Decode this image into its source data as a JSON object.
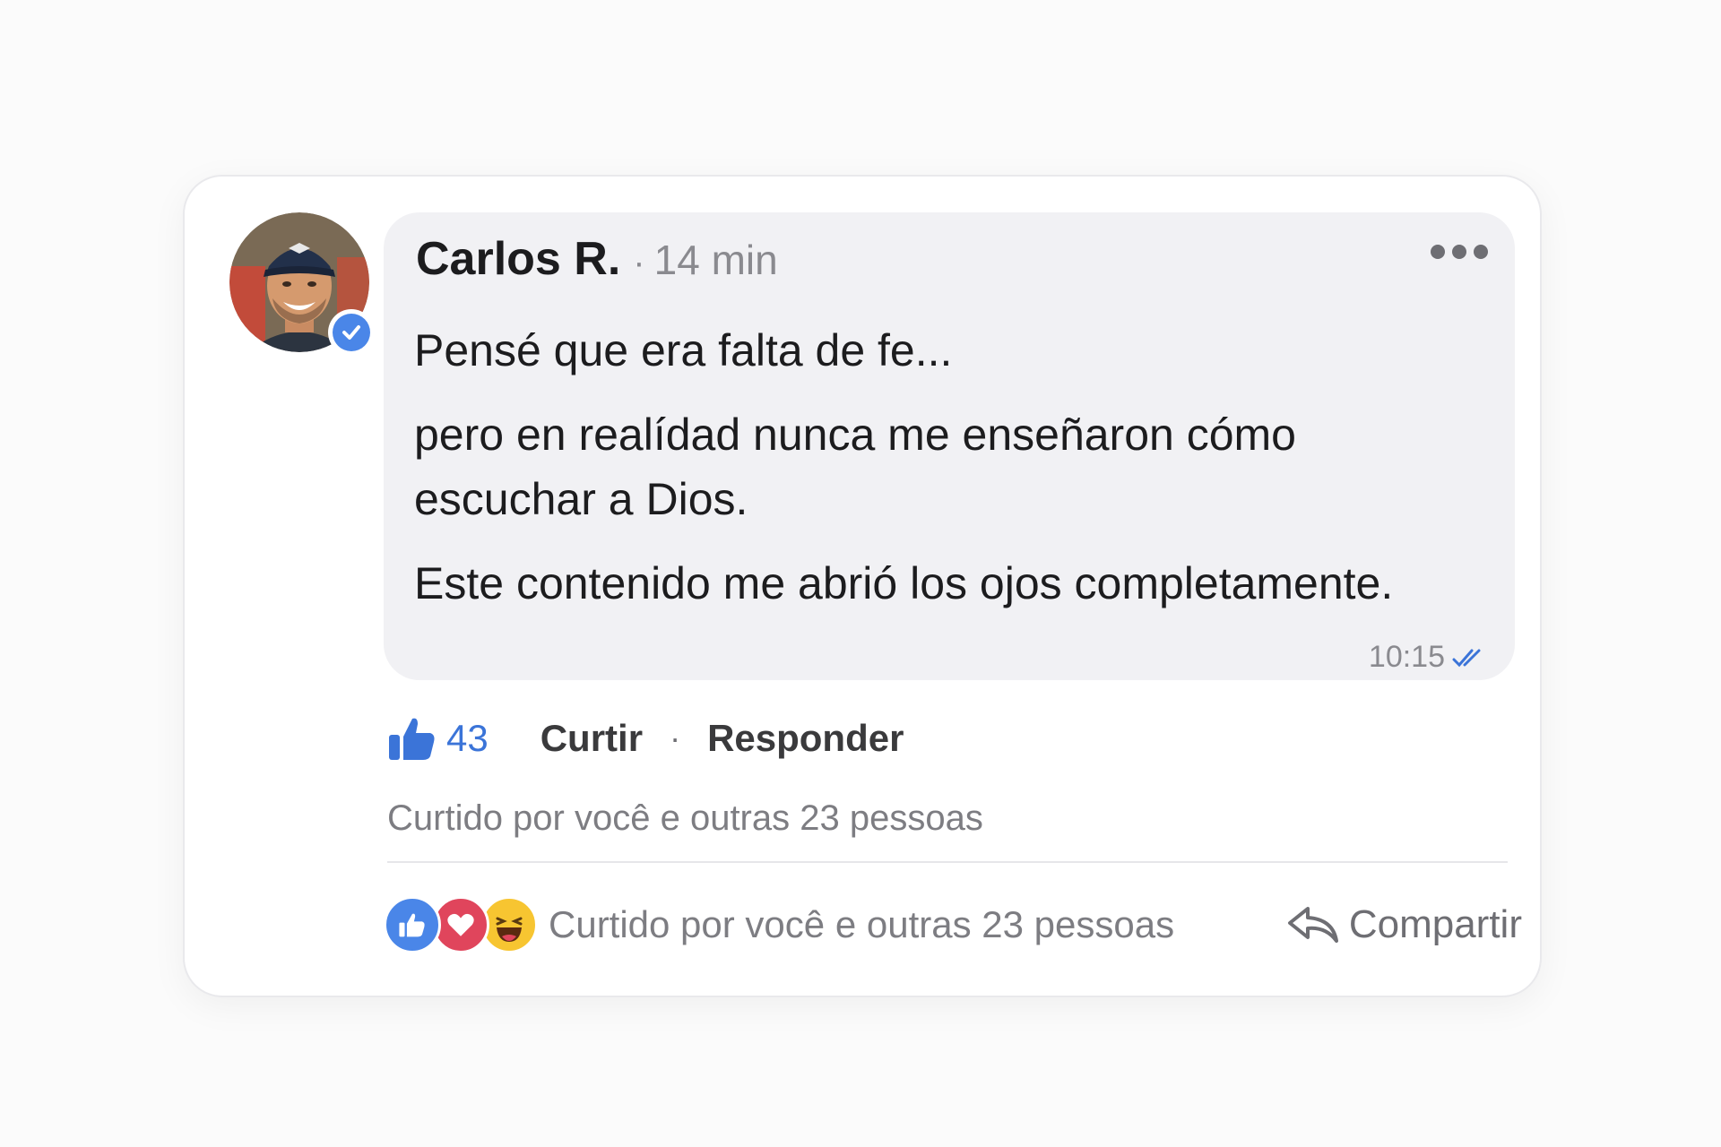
{
  "comment": {
    "author": "Carlos R.",
    "separator": "·",
    "time_ago": "14 min",
    "verified": true,
    "lines": [
      "Pensé que era falta de fe...",
      "pero en realídad nunca me enseñaron cómo escuchar a Dios.",
      "Este contenido me abrió los ojos completamente."
    ],
    "timestamp": "10:15",
    "read_receipt_color": "#3b74d8",
    "bubble_color": "#f1f1f4"
  },
  "actions": {
    "like_count": "43",
    "like_label": "Curtir",
    "separator": "·",
    "reply_label": "Responder"
  },
  "liked_by": "Curtido por você e outras 23 pessoas",
  "footer": {
    "reactions": [
      "thumbs-up-icon",
      "heart-icon",
      "laughing-face-icon"
    ],
    "text": "Curtido por você e outras 23 pessoas",
    "share_label": "Compartir"
  },
  "colors": {
    "accent": "#3b74d8",
    "like_reaction": "#4a86e8",
    "love_reaction": "#e0455c",
    "haha_reaction": "#f7c531"
  }
}
